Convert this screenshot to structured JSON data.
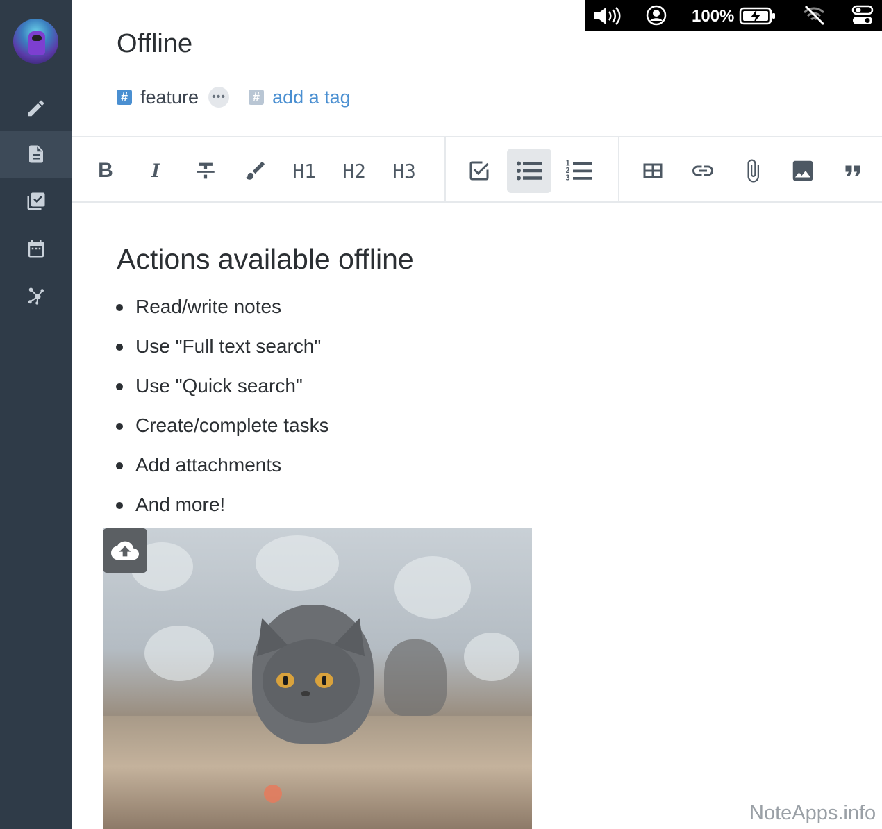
{
  "status_bar": {
    "battery_percent": "100%",
    "icons": [
      "volume-icon",
      "user-circle-icon",
      "battery-charging-icon",
      "wifi-off-icon",
      "control-center-icon"
    ]
  },
  "sidebar": {
    "items": [
      {
        "icon": "pencil-icon",
        "name": "new-note"
      },
      {
        "icon": "document-icon",
        "name": "notes",
        "active": true
      },
      {
        "icon": "tasks-icon",
        "name": "tasks"
      },
      {
        "icon": "calendar-icon",
        "name": "calendar"
      },
      {
        "icon": "graph-icon",
        "name": "graph"
      }
    ]
  },
  "note": {
    "title": "Offline",
    "tags": [
      {
        "label": "feature"
      }
    ],
    "add_tag_label": "add a tag"
  },
  "toolbar": {
    "buttons": [
      {
        "name": "bold",
        "label": "B"
      },
      {
        "name": "italic",
        "label": "I"
      },
      {
        "name": "strikethrough",
        "label": ""
      },
      {
        "name": "highlight",
        "label": ""
      },
      {
        "name": "heading-1",
        "label": "H1"
      },
      {
        "name": "heading-2",
        "label": "H2"
      },
      {
        "name": "heading-3",
        "label": "H3"
      },
      {
        "name": "checklist",
        "label": ""
      },
      {
        "name": "bullet-list",
        "label": "",
        "active": true
      },
      {
        "name": "numbered-list",
        "label": ""
      },
      {
        "name": "table",
        "label": ""
      },
      {
        "name": "link",
        "label": ""
      },
      {
        "name": "attachment",
        "label": ""
      },
      {
        "name": "image",
        "label": ""
      },
      {
        "name": "quote",
        "label": ""
      }
    ]
  },
  "content": {
    "heading": "Actions available offline",
    "bullets": [
      "Read/write notes",
      "Use \"Full text search\"",
      "Use \"Quick search\"",
      "Create/complete tasks",
      "Add attachments",
      "And more!"
    ]
  },
  "watermark": "NoteApps.info",
  "colors": {
    "sidebar_bg": "#2f3b48",
    "sidebar_active": "#3d4a58",
    "accent": "#4a8fd1",
    "text": "#2b2f33"
  }
}
